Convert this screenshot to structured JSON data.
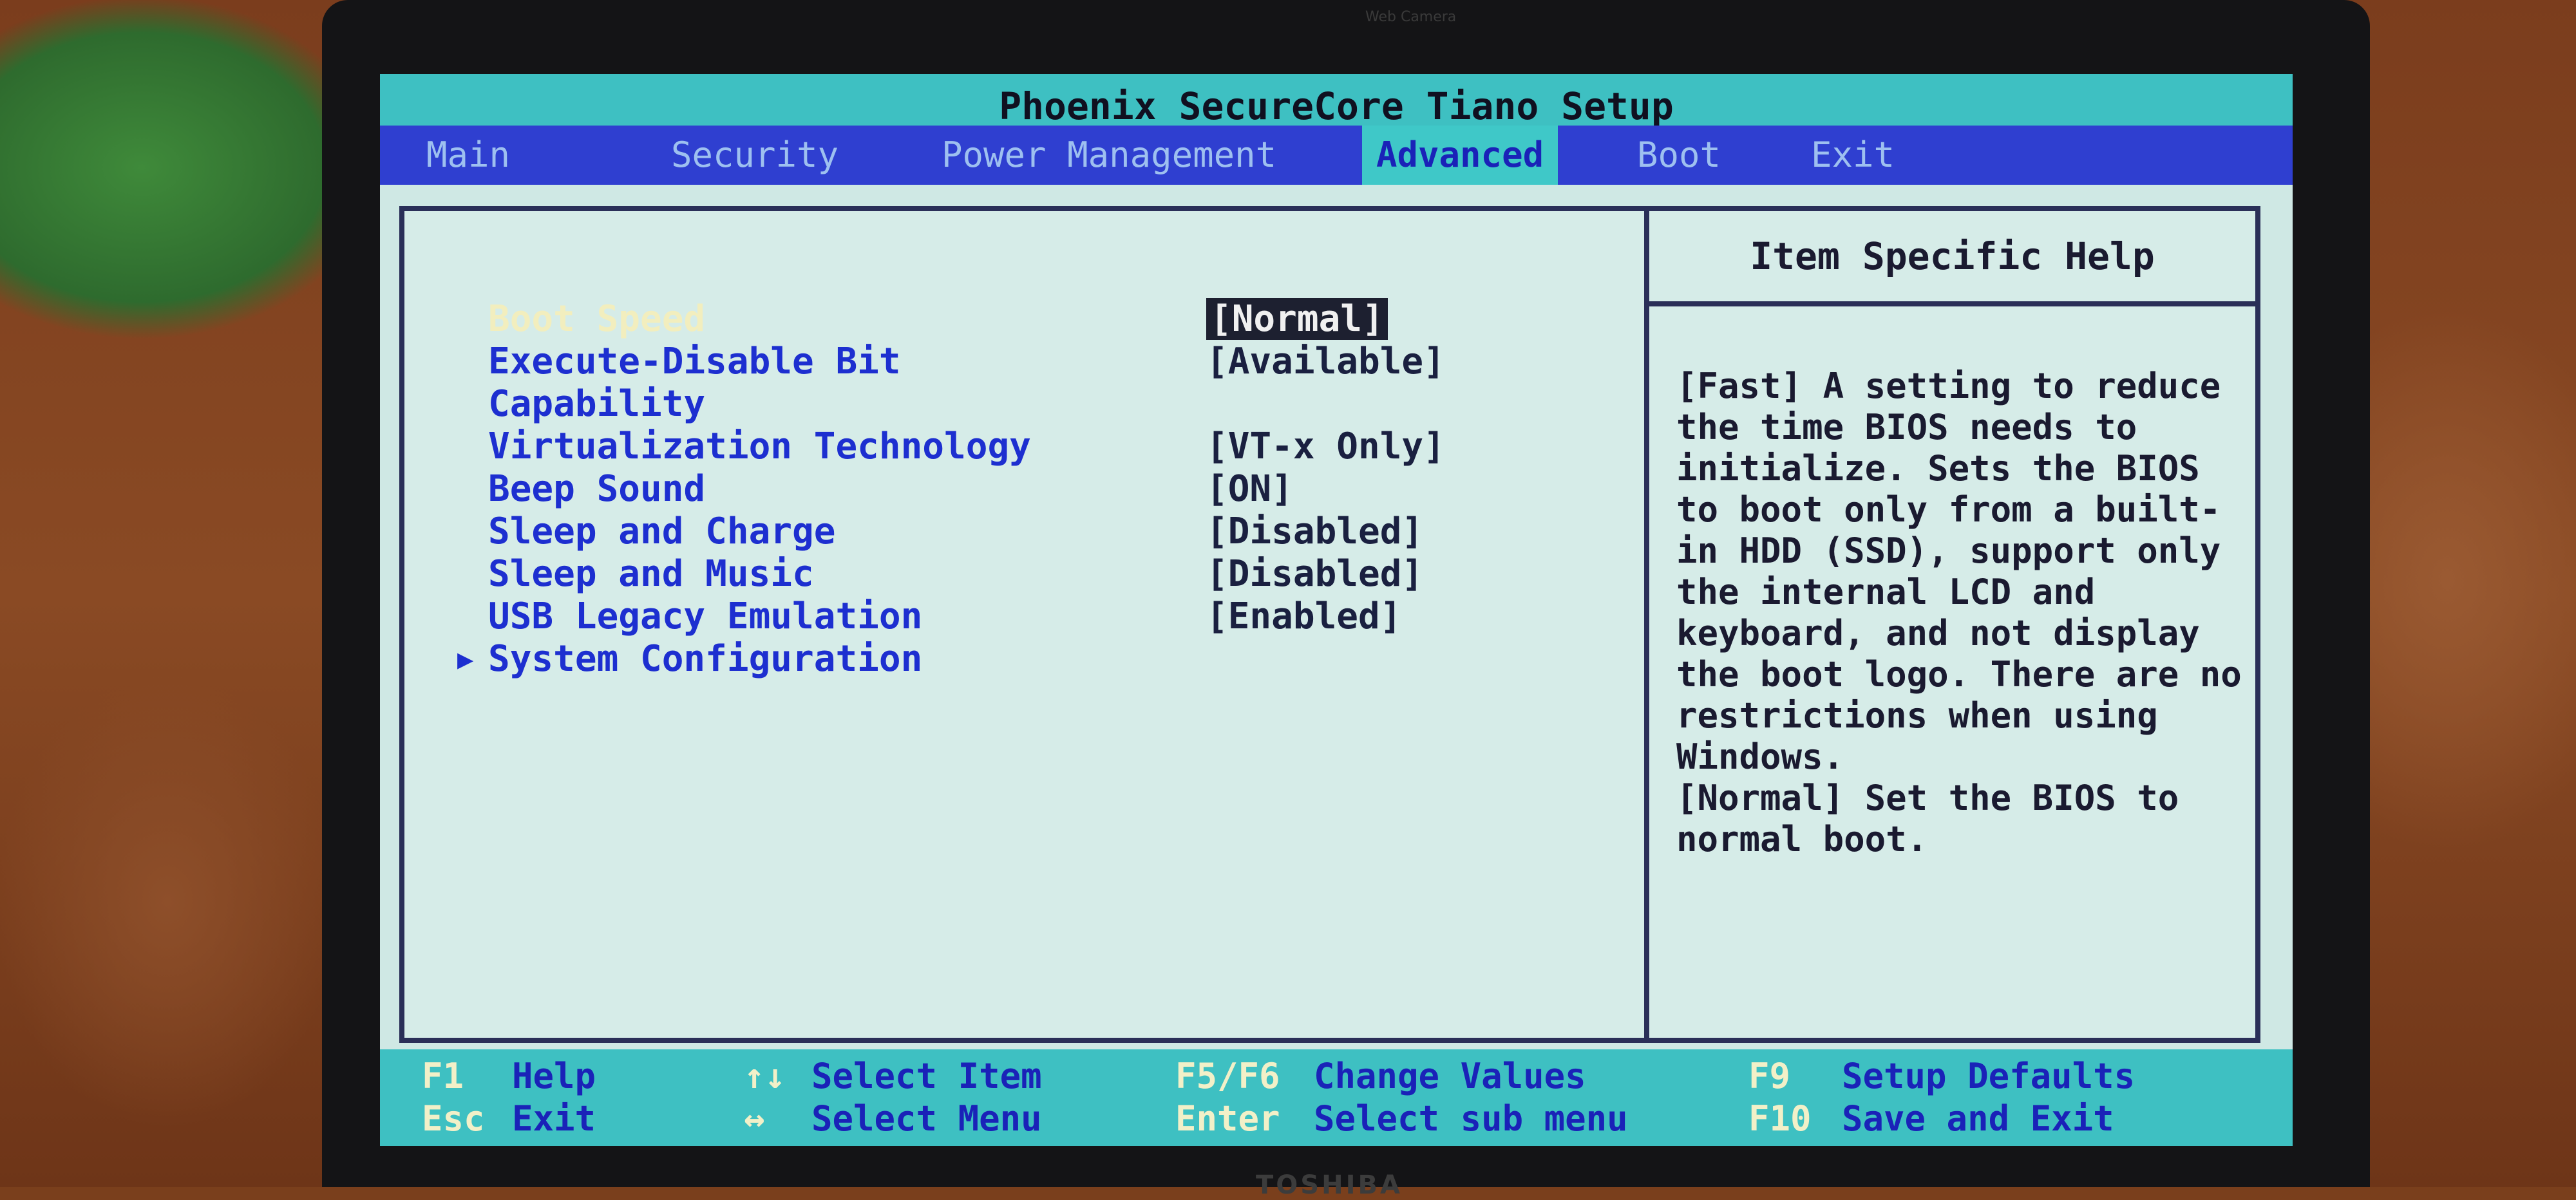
{
  "title": "Phoenix SecureCore Tiano Setup",
  "menu": {
    "tabs": [
      {
        "label": "Main"
      },
      {
        "label": "Security"
      },
      {
        "label": "Power Management"
      },
      {
        "label": "Advanced",
        "active": true
      },
      {
        "label": "Boot"
      },
      {
        "label": "Exit"
      }
    ]
  },
  "settings": [
    {
      "label": "Boot Speed",
      "value": "[Normal]",
      "selected": true
    },
    {
      "label": "Execute-Disable Bit",
      "value": "[Available]"
    },
    {
      "label": "Capability",
      "value": ""
    },
    {
      "label": "Virtualization Technology",
      "value": "[VT-x Only]"
    },
    {
      "label": "Beep Sound",
      "value": "[ON]"
    },
    {
      "label": "Sleep and Charge",
      "value": "[Disabled]"
    },
    {
      "label": "Sleep and Music",
      "value": "[Disabled]"
    },
    {
      "label": "USB Legacy Emulation",
      "value": "[Enabled]"
    },
    {
      "label": "System Configuration",
      "value": "",
      "submenu": true
    }
  ],
  "submenu_marker": "▶",
  "help": {
    "header": "Item Specific Help",
    "text": "[Fast] A setting to reduce the time BIOS needs to initialize. Sets the BIOS to boot only from a built-in HDD (SSD), support only the internal LCD and keyboard, and not display the boot logo. There are no restrictions when using Windows.\n[Normal] Set the BIOS to normal boot."
  },
  "footer": {
    "f1": {
      "key": "F1",
      "label": "Help"
    },
    "esc": {
      "key": "Esc",
      "label": "Exit"
    },
    "updown": {
      "key": "↑↓",
      "label": "Select Item"
    },
    "leftright": {
      "key": "↔",
      "label": "Select Menu"
    },
    "f5f6": {
      "key": "F5/F6",
      "label": "Change Values"
    },
    "enter": {
      "key": "Enter",
      "label": "Select sub menu"
    },
    "f9": {
      "key": "F9",
      "label": "Setup Defaults"
    },
    "f10": {
      "key": "F10",
      "label": "Save and Exit"
    }
  },
  "hardware": {
    "webcam_label": "Web Camera",
    "brand": "TOSHIBA"
  },
  "colors": {
    "title_bar": "#3ec0c2",
    "menu_bar": "#2f3fd0",
    "panel": "#d6ece8",
    "item_text": "#1d2fd0",
    "selected_item_text": "#f2eebe"
  }
}
